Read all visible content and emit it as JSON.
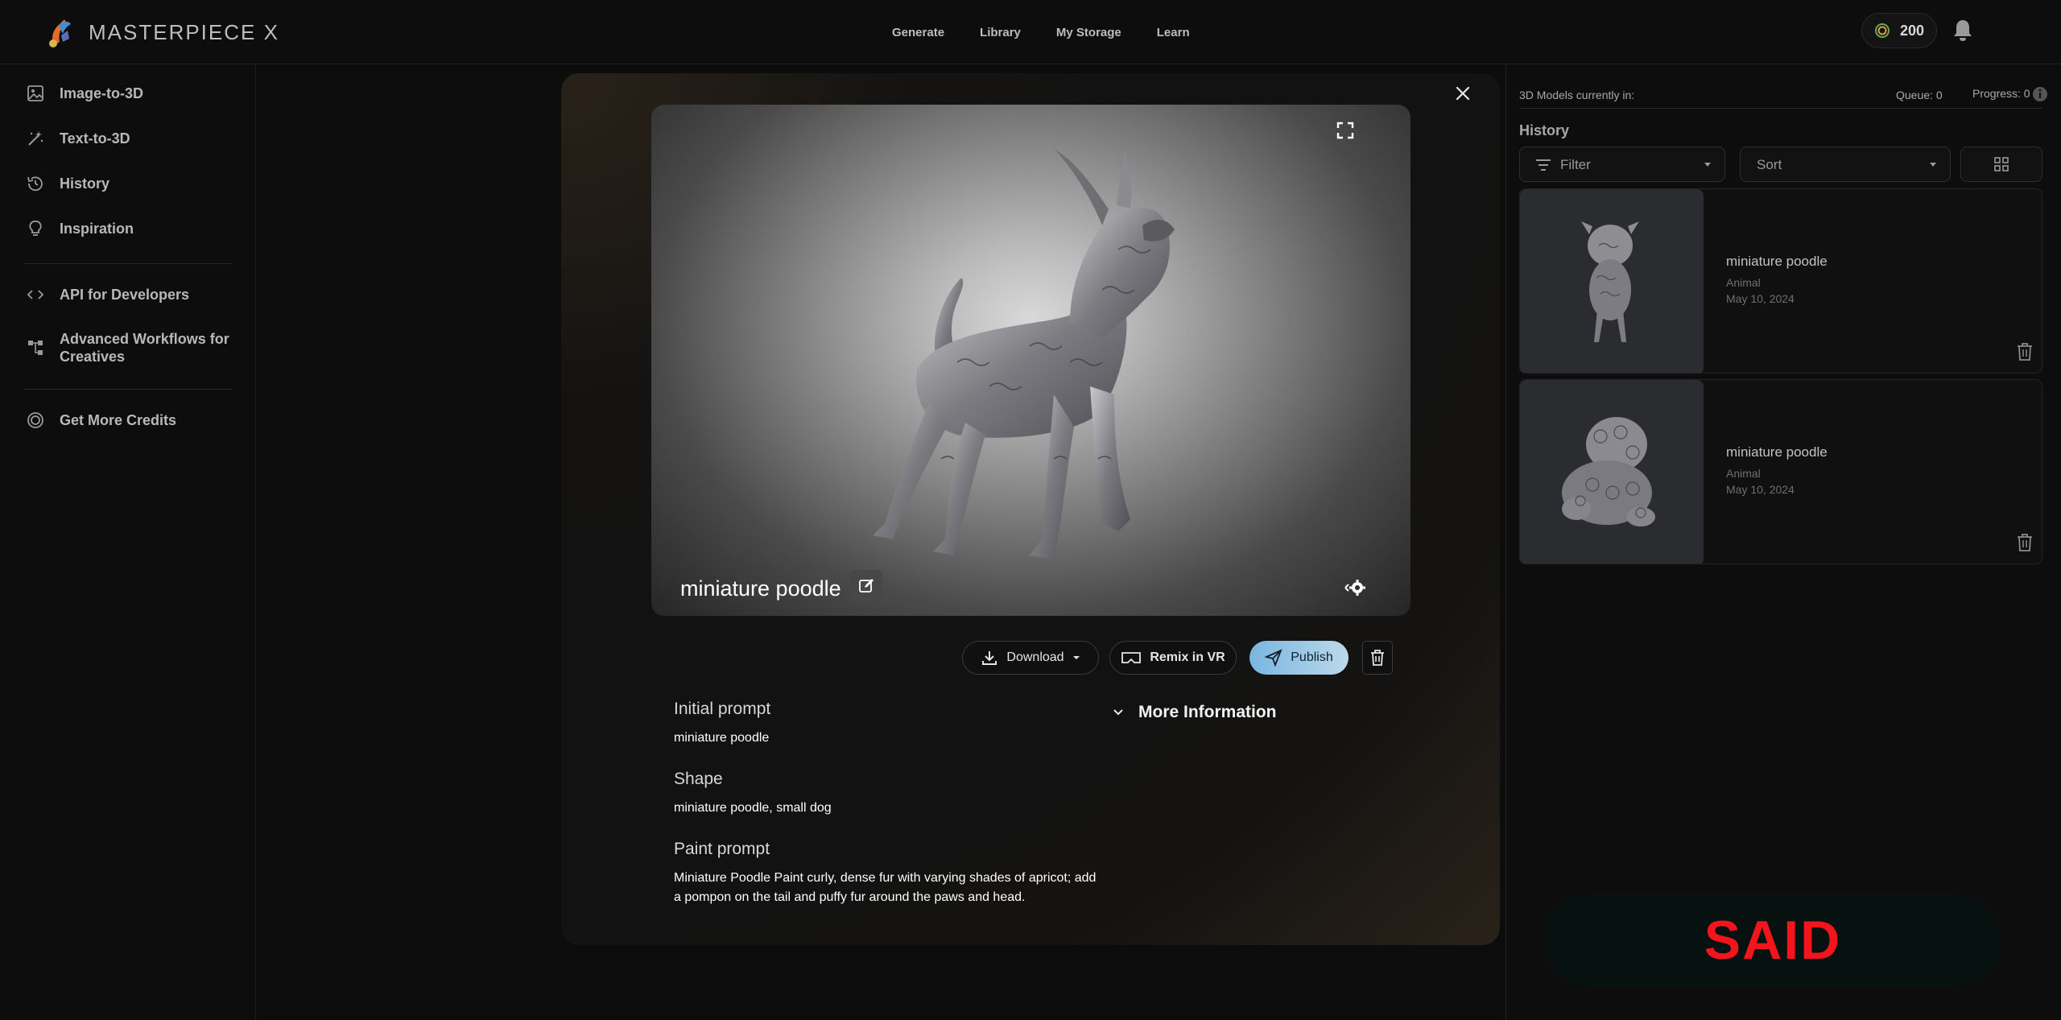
{
  "brand": {
    "name": "MASTERPIECE X"
  },
  "nav": {
    "items": [
      "Generate",
      "Library",
      "My Storage",
      "Learn"
    ]
  },
  "credits": {
    "value": "200"
  },
  "sidebar": {
    "items": [
      {
        "label": "Image-to-3D",
        "icon": "image-icon"
      },
      {
        "label": "Text-to-3D",
        "icon": "magic-wand-icon"
      },
      {
        "label": "History",
        "icon": "history-clock-icon"
      },
      {
        "label": "Inspiration",
        "icon": "lightbulb-icon"
      },
      {
        "label": "API for Developers",
        "icon": "code-icon"
      },
      {
        "label": "Advanced Workflows for Creatives",
        "icon": "workflow-icon"
      },
      {
        "label": "Get More Credits",
        "icon": "credits-coin-icon"
      }
    ]
  },
  "modal": {
    "title": "miniature poodle",
    "actions": {
      "download": "Download",
      "remix": "Remix in VR",
      "publish": "Publish"
    },
    "details": {
      "initial_prompt_label": "Initial prompt",
      "initial_prompt": "miniature poodle",
      "shape_label": "Shape",
      "shape": "miniature poodle, small dog",
      "paint_prompt_label": "Paint prompt",
      "paint_prompt": "Miniature Poodle Paint curly, dense fur with varying shades of apricot; add a pompon on the tail and puffy fur around the paws and head."
    },
    "more_information": "More Information"
  },
  "right_panel": {
    "queue_label": "3D Models currently in:",
    "queue": "Queue: 0",
    "progress": "Progress: 0",
    "history_title": "History",
    "filter_label": "Filter",
    "sort_label": "Sort",
    "cards": [
      {
        "name": "miniature poodle",
        "category": "Animal",
        "date": "May 10, 2024"
      },
      {
        "name": "miniature poodle",
        "category": "Animal",
        "date": "May 10, 2024"
      }
    ]
  },
  "watermark": {
    "text": "SAID"
  },
  "colors": {
    "accent_publish": "#78b6e0",
    "watermark_red": "#f3141c",
    "background": "#0c0c0c"
  }
}
